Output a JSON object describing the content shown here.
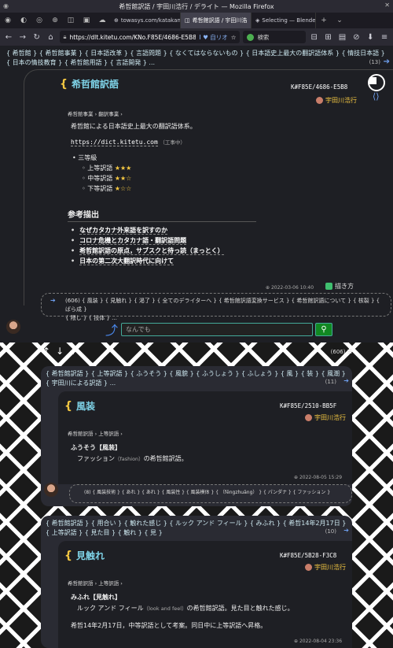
{
  "window": {
    "title": "希哲館訳語 / 宇田川浩行 / デライト — Mozilla Firefox",
    "close": "✕"
  },
  "tabs": [
    {
      "label": "",
      "icon": "tab-icon",
      "glyph": "◉"
    },
    {
      "label": "",
      "icon": "tab-icon",
      "glyph": "◐"
    },
    {
      "label": "",
      "icon": "tab-icon",
      "glyph": "◎"
    },
    {
      "label": "",
      "icon": "tab-icon",
      "glyph": "⊕"
    },
    {
      "label": "",
      "icon": "tab-icon",
      "glyph": "◫"
    },
    {
      "label": "",
      "icon": "tab-icon",
      "glyph": "▣"
    },
    {
      "label": "",
      "icon": "tab-icon",
      "glyph": "☁"
    },
    {
      "label": "towasys.com/katakana",
      "glyph": "⊕",
      "close": "✕"
    },
    {
      "label": "希哲館訳語 / 宇田川浩",
      "glyph": "◫",
      "close": "✕",
      "active": true
    },
    {
      "label": "Selecting — Blender",
      "glyph": "◈",
      "close": "✕"
    }
  ],
  "tabbar": {
    "new_tab": "+",
    "list_all": "⌄"
  },
  "nav": {
    "back": "←",
    "forward": "→",
    "reload": "↻",
    "home": "⌂",
    "url": "https://dlt.kitetu.com/KNo.F85E/4686-E5B8",
    "translate_label": "I ♥ 自リオ",
    "search_placeholder": "検索",
    "search_icon_glyph": "G",
    "bookmark": "☆",
    "menu": "≡",
    "extensions": [
      "⊟",
      "⊞",
      "▤",
      "⊘",
      "⬇",
      "★"
    ]
  },
  "top_tags": {
    "lines": [
      "{ 希哲館 } { 希哲館事業 } { 日本語改革 } { 言語問題 } { なくてはならないもの } { 日本語史上最大の翻訳語体系 } { 情技日本語 }",
      "{ 日本の情技教育 } { 希哲館用語 } { 言語開発 } ..."
    ],
    "count": "(13)"
  },
  "main": {
    "title": "希哲館訳語",
    "knowledge_id": "K#F85E/4686-E5B8",
    "author": "宇田川浩行",
    "breadcrumb": [
      "希哲館事業",
      "翻訳事業"
    ],
    "description": "希哲館による日本語史上最大の翻訳語体系。",
    "link": "https://dict.kitetu.com",
    "link_note": "（工事中）",
    "levels_title": "三等級",
    "levels": [
      {
        "label": "上等訳語",
        "stars": "★★★"
      },
      {
        "label": "中等訳語",
        "stars": "★★☆"
      },
      {
        "label": "下等訳語",
        "stars": "★☆☆"
      }
    ],
    "section": "参考描出",
    "refs": [
      "なぜカタカナ外来語を訳すのか",
      "コロナ危機とカタカナ語・翻訳語問題",
      "希哲館訳語の原点，サブスクと待っ読（まっとく）",
      "日本の第二次大翻訳時代に向けて"
    ],
    "date": "2022-03-06 10:40",
    "draw_button": "描き方"
  },
  "sub_tags": {
    "lines": [
      "(606) { 風装 } { 見触れ } { 渇了 } { 全てのデライターへ } { 希哲館訳語変換サービス } { 希哲館訳語について } { 核裂 } { ばら成 }",
      "{ 隈し } { 技体 } ..."
    ]
  },
  "search": {
    "placeholder": "なんでも",
    "button": "⚲"
  },
  "lower": {
    "count": "(606)",
    "tools": [
      "↥",
      "↓",
      "+"
    ],
    "card1": {
      "tags": [
        "{ 希哲館訳語 } { 上等訳語 } { ふうそう } { 風貌 } { ふうしょう } { ふしょう } { 風 } { 装 } { 風潮 }",
        "{ 宇田川による訳語 } ..."
      ],
      "count": "(11)",
      "title": "風装",
      "knowledge_id": "K#F85E/2510-BB5F",
      "author": "宇田川浩行",
      "breadcrumb": [
        "希哲館訳語",
        "上等訳語"
      ],
      "reading": "ふうそう【風装】",
      "definition": "ファッション",
      "definition_en": "（fashion）",
      "definition_tail": "の希哲館訳語。",
      "date": "2022-08-05 15:29",
      "related": "(8) { 風装技術 } { あれ } { あれ } { 風装性 } { 風装模体 } { （fēngzhuāng） } { パンダナ } { ファッション }"
    },
    "card2": {
      "tags": [
        "{ 希哲館訳語 } { 用合い } { 触れた感じ } { ルック アンド フィール } { みふれ } { 希哲14年2月17日 }",
        "{ 上等訳語 } { 見た目 } { 触れ } { 見 }"
      ],
      "count": "(10)",
      "title": "見触れ",
      "knowledge_id": "K#F85E/5B28-F3C8",
      "author": "宇田川浩行",
      "breadcrumb": [
        "希哲館訳語",
        "上等訳語"
      ],
      "reading": "みふれ【見触れ】",
      "definition": "ルック アンド フィール",
      "definition_en": "（look and feel）",
      "definition_tail": "の希哲館訳語。見た目と触れた感じ。",
      "note": "希哲14年2月17日，中等訳語として考案。同日中に上等訳語へ昇格。",
      "date": "2022-08-04 23:36"
    }
  }
}
